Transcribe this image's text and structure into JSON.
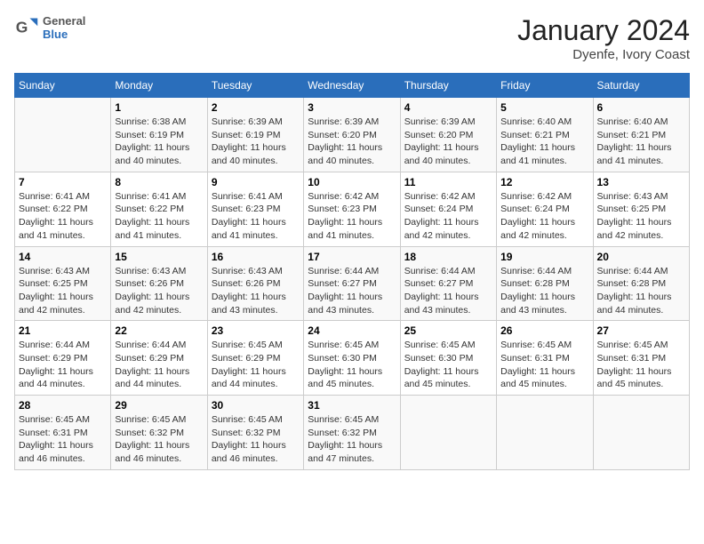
{
  "header": {
    "logo_line1": "General",
    "logo_line2": "Blue",
    "title": "January 2024",
    "subtitle": "Dyenfe, Ivory Coast"
  },
  "days_of_week": [
    "Sunday",
    "Monday",
    "Tuesday",
    "Wednesday",
    "Thursday",
    "Friday",
    "Saturday"
  ],
  "weeks": [
    [
      {
        "date": "",
        "info": ""
      },
      {
        "date": "1",
        "info": "Sunrise: 6:38 AM\nSunset: 6:19 PM\nDaylight: 11 hours\nand 40 minutes."
      },
      {
        "date": "2",
        "info": "Sunrise: 6:39 AM\nSunset: 6:19 PM\nDaylight: 11 hours\nand 40 minutes."
      },
      {
        "date": "3",
        "info": "Sunrise: 6:39 AM\nSunset: 6:20 PM\nDaylight: 11 hours\nand 40 minutes."
      },
      {
        "date": "4",
        "info": "Sunrise: 6:39 AM\nSunset: 6:20 PM\nDaylight: 11 hours\nand 40 minutes."
      },
      {
        "date": "5",
        "info": "Sunrise: 6:40 AM\nSunset: 6:21 PM\nDaylight: 11 hours\nand 41 minutes."
      },
      {
        "date": "6",
        "info": "Sunrise: 6:40 AM\nSunset: 6:21 PM\nDaylight: 11 hours\nand 41 minutes."
      }
    ],
    [
      {
        "date": "7",
        "info": "Sunrise: 6:41 AM\nSunset: 6:22 PM\nDaylight: 11 hours\nand 41 minutes."
      },
      {
        "date": "8",
        "info": "Sunrise: 6:41 AM\nSunset: 6:22 PM\nDaylight: 11 hours\nand 41 minutes."
      },
      {
        "date": "9",
        "info": "Sunrise: 6:41 AM\nSunset: 6:23 PM\nDaylight: 11 hours\nand 41 minutes."
      },
      {
        "date": "10",
        "info": "Sunrise: 6:42 AM\nSunset: 6:23 PM\nDaylight: 11 hours\nand 41 minutes."
      },
      {
        "date": "11",
        "info": "Sunrise: 6:42 AM\nSunset: 6:24 PM\nDaylight: 11 hours\nand 42 minutes."
      },
      {
        "date": "12",
        "info": "Sunrise: 6:42 AM\nSunset: 6:24 PM\nDaylight: 11 hours\nand 42 minutes."
      },
      {
        "date": "13",
        "info": "Sunrise: 6:43 AM\nSunset: 6:25 PM\nDaylight: 11 hours\nand 42 minutes."
      }
    ],
    [
      {
        "date": "14",
        "info": "Sunrise: 6:43 AM\nSunset: 6:25 PM\nDaylight: 11 hours\nand 42 minutes."
      },
      {
        "date": "15",
        "info": "Sunrise: 6:43 AM\nSunset: 6:26 PM\nDaylight: 11 hours\nand 42 minutes."
      },
      {
        "date": "16",
        "info": "Sunrise: 6:43 AM\nSunset: 6:26 PM\nDaylight: 11 hours\nand 43 minutes."
      },
      {
        "date": "17",
        "info": "Sunrise: 6:44 AM\nSunset: 6:27 PM\nDaylight: 11 hours\nand 43 minutes."
      },
      {
        "date": "18",
        "info": "Sunrise: 6:44 AM\nSunset: 6:27 PM\nDaylight: 11 hours\nand 43 minutes."
      },
      {
        "date": "19",
        "info": "Sunrise: 6:44 AM\nSunset: 6:28 PM\nDaylight: 11 hours\nand 43 minutes."
      },
      {
        "date": "20",
        "info": "Sunrise: 6:44 AM\nSunset: 6:28 PM\nDaylight: 11 hours\nand 44 minutes."
      }
    ],
    [
      {
        "date": "21",
        "info": "Sunrise: 6:44 AM\nSunset: 6:29 PM\nDaylight: 11 hours\nand 44 minutes."
      },
      {
        "date": "22",
        "info": "Sunrise: 6:44 AM\nSunset: 6:29 PM\nDaylight: 11 hours\nand 44 minutes."
      },
      {
        "date": "23",
        "info": "Sunrise: 6:45 AM\nSunset: 6:29 PM\nDaylight: 11 hours\nand 44 minutes."
      },
      {
        "date": "24",
        "info": "Sunrise: 6:45 AM\nSunset: 6:30 PM\nDaylight: 11 hours\nand 45 minutes."
      },
      {
        "date": "25",
        "info": "Sunrise: 6:45 AM\nSunset: 6:30 PM\nDaylight: 11 hours\nand 45 minutes."
      },
      {
        "date": "26",
        "info": "Sunrise: 6:45 AM\nSunset: 6:31 PM\nDaylight: 11 hours\nand 45 minutes."
      },
      {
        "date": "27",
        "info": "Sunrise: 6:45 AM\nSunset: 6:31 PM\nDaylight: 11 hours\nand 45 minutes."
      }
    ],
    [
      {
        "date": "28",
        "info": "Sunrise: 6:45 AM\nSunset: 6:31 PM\nDaylight: 11 hours\nand 46 minutes."
      },
      {
        "date": "29",
        "info": "Sunrise: 6:45 AM\nSunset: 6:32 PM\nDaylight: 11 hours\nand 46 minutes."
      },
      {
        "date": "30",
        "info": "Sunrise: 6:45 AM\nSunset: 6:32 PM\nDaylight: 11 hours\nand 46 minutes."
      },
      {
        "date": "31",
        "info": "Sunrise: 6:45 AM\nSunset: 6:32 PM\nDaylight: 11 hours\nand 47 minutes."
      },
      {
        "date": "",
        "info": ""
      },
      {
        "date": "",
        "info": ""
      },
      {
        "date": "",
        "info": ""
      }
    ]
  ]
}
